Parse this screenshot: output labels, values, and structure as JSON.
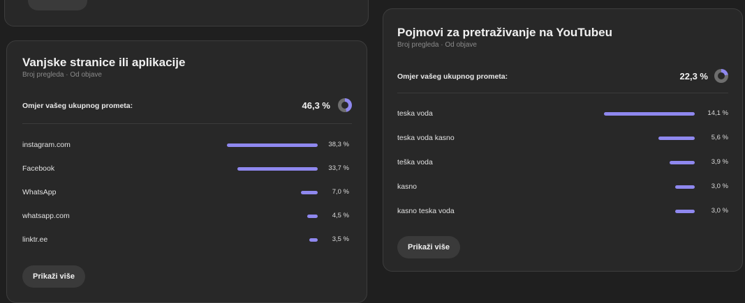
{
  "accent_color": "#8f88ef",
  "external": {
    "title": "Vanjske stranice ili aplikacije",
    "subtitle": "Broj pregleda · Od objave",
    "ratio_label": "Omjer vašeg ukupnog prometa:",
    "ratio_value": "46,3 %",
    "ratio_fraction": 0.463,
    "rows": [
      {
        "label": "instagram.com",
        "value": "38,3 %",
        "percent": 38.3
      },
      {
        "label": "Facebook",
        "value": "33,7 %",
        "percent": 33.7
      },
      {
        "label": "WhatsApp",
        "value": "7,0 %",
        "percent": 7.0
      },
      {
        "label": "whatsapp.com",
        "value": "4,5 %",
        "percent": 4.5
      },
      {
        "label": "linktr.ee",
        "value": "3,5 %",
        "percent": 3.5
      }
    ],
    "more_label": "Prikaži više"
  },
  "youtube": {
    "title": "Pojmovi za pretraživanje na YouTubeu",
    "subtitle": "Broj pregleda · Od objave",
    "ratio_label": "Omjer vašeg ukupnog prometa:",
    "ratio_value": "22,3 %",
    "ratio_fraction": 0.223,
    "rows": [
      {
        "label": "teska voda",
        "value": "14,1 %",
        "percent": 14.1
      },
      {
        "label": "teska voda kasno",
        "value": "5,6 %",
        "percent": 5.6
      },
      {
        "label": "teška voda",
        "value": "3,9 %",
        "percent": 3.9
      },
      {
        "label": "kasno",
        "value": "3,0 %",
        "percent": 3.0
      },
      {
        "label": "kasno teska voda",
        "value": "3,0 %",
        "percent": 3.0
      }
    ],
    "more_label": "Prikaži više"
  }
}
